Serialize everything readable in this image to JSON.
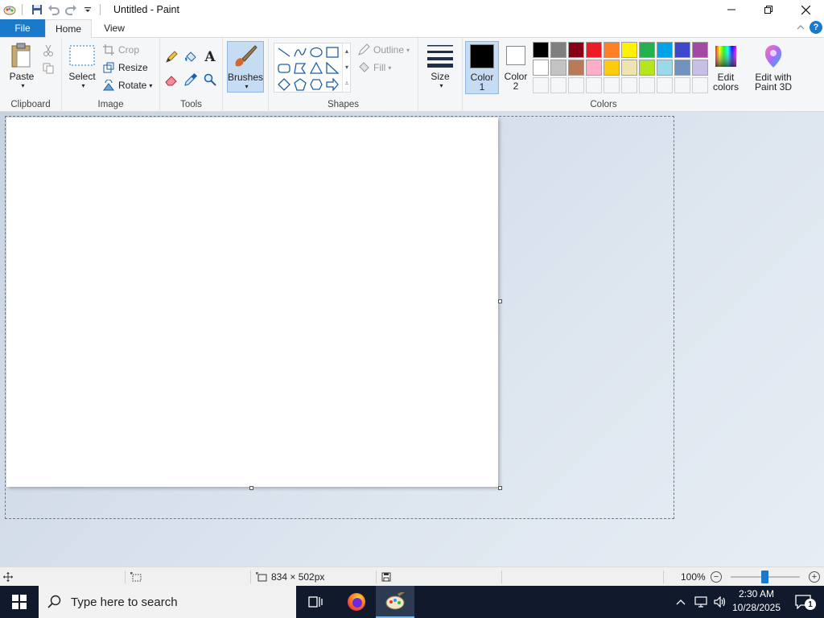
{
  "window": {
    "title": "Untitled - Paint",
    "controls": [
      "minimize-icon",
      "restore-icon",
      "close-icon"
    ]
  },
  "quick_access": [
    "save-icon",
    "undo-icon",
    "redo-icon",
    "customize-icon"
  ],
  "tabs": {
    "file": "File",
    "home": "Home",
    "view": "View"
  },
  "ribbon": {
    "clipboard": {
      "label": "Clipboard",
      "paste": "Paste"
    },
    "image": {
      "label": "Image",
      "select": "Select",
      "crop": "Crop",
      "resize": "Resize",
      "rotate": "Rotate"
    },
    "tools": {
      "label": "Tools"
    },
    "brushes": {
      "label": "Brushes"
    },
    "shapes": {
      "label": "Shapes",
      "outline": "Outline",
      "fill": "Fill"
    },
    "size": {
      "label": "Size"
    },
    "colors": {
      "label": "Colors",
      "color1": "Color",
      "color1_num": "1",
      "color2": "Color",
      "color2_num": "2",
      "edit_colors_1": "Edit",
      "edit_colors_2": "colors",
      "paint3d_1": "Edit with",
      "paint3d_2": "Paint 3D",
      "row1": [
        "#000000",
        "#7f7f7f",
        "#880015",
        "#ed1c24",
        "#ff7f27",
        "#fff200",
        "#22b14c",
        "#00a2e8",
        "#3f48cc",
        "#a349a4"
      ],
      "row2": [
        "#ffffff",
        "#c3c3c3",
        "#b97a57",
        "#ffaec9",
        "#ffc90e",
        "#efe4b0",
        "#b5e61d",
        "#99d9ea",
        "#7092be",
        "#c8bfe7"
      ],
      "primary": "#000000",
      "secondary": "#ffffff"
    }
  },
  "statusbar": {
    "dimensions": "834 × 502px",
    "zoom": "100%"
  },
  "taskbar": {
    "search_placeholder": "Type here to search",
    "time": "2:30 AM",
    "date": "10/28/2025",
    "notifications": "1"
  }
}
